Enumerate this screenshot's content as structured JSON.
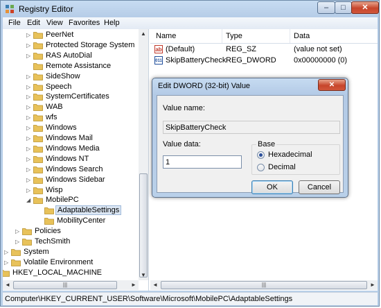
{
  "window": {
    "title": "Registry Editor",
    "min_glyph": "–",
    "max_glyph": "□",
    "close_glyph": "✕"
  },
  "menu": [
    "File",
    "Edit",
    "View",
    "Favorites",
    "Help"
  ],
  "tree": [
    {
      "label": "PeerNet",
      "expander": "▷"
    },
    {
      "label": "Protected Storage System",
      "expander": "▷"
    },
    {
      "label": "RAS AutoDial",
      "expander": "▷"
    },
    {
      "label": "Remote Assistance",
      "expander": ""
    },
    {
      "label": "SideShow",
      "expander": "▷"
    },
    {
      "label": "Speech",
      "expander": "▷"
    },
    {
      "label": "SystemCertificates",
      "expander": "▷"
    },
    {
      "label": "WAB",
      "expander": "▷"
    },
    {
      "label": "wfs",
      "expander": "▷"
    },
    {
      "label": "Windows",
      "expander": "▷"
    },
    {
      "label": "Windows Mail",
      "expander": "▷"
    },
    {
      "label": "Windows Media",
      "expander": "▷"
    },
    {
      "label": "Windows NT",
      "expander": "▷"
    },
    {
      "label": "Windows Search",
      "expander": "▷"
    },
    {
      "label": "Windows Sidebar",
      "expander": "▷"
    },
    {
      "label": "Wisp",
      "expander": "▷"
    },
    {
      "label": "MobilePC",
      "expander": "◢"
    },
    {
      "label": "AdaptableSettings",
      "expander": ""
    },
    {
      "label": "MobilityCenter",
      "expander": ""
    },
    {
      "label": "Policies",
      "expander": "▷"
    },
    {
      "label": "TechSmith",
      "expander": "▷"
    },
    {
      "label": "System",
      "expander": "▷"
    },
    {
      "label": "Volatile Environment",
      "expander": "▷"
    },
    {
      "label": "HKEY_LOCAL_MACHINE",
      "expander": "▷"
    }
  ],
  "list": {
    "columns": [
      "Name",
      "Type",
      "Data"
    ],
    "rows": [
      {
        "icon": "ab",
        "name": "(Default)",
        "type": "REG_SZ",
        "data": "(value not set)"
      },
      {
        "icon": "011",
        "name": "SkipBatteryCheck",
        "type": "REG_DWORD",
        "data": "0x00000000 (0)"
      }
    ]
  },
  "status": "Computer\\HKEY_CURRENT_USER\\Software\\Microsoft\\MobilePC\\AdaptableSettings",
  "dialog": {
    "title": "Edit DWORD (32-bit) Value",
    "close_glyph": "✕",
    "value_name_label": "Value name:",
    "value_name": "SkipBatteryCheck",
    "value_data_label": "Value data:",
    "value_data": "1",
    "base_label": "Base",
    "hex_label": "Hexadecimal",
    "dec_label": "Decimal",
    "ok_label": "OK",
    "cancel_label": "Cancel"
  },
  "scroll": {
    "up": "▲",
    "down": "▼",
    "left": "◄",
    "right": "►",
    "grip": "|||"
  },
  "colors": {
    "accent": "#3c7fb1",
    "folder": "#e8c25a",
    "selection": "#dbe6f3"
  }
}
